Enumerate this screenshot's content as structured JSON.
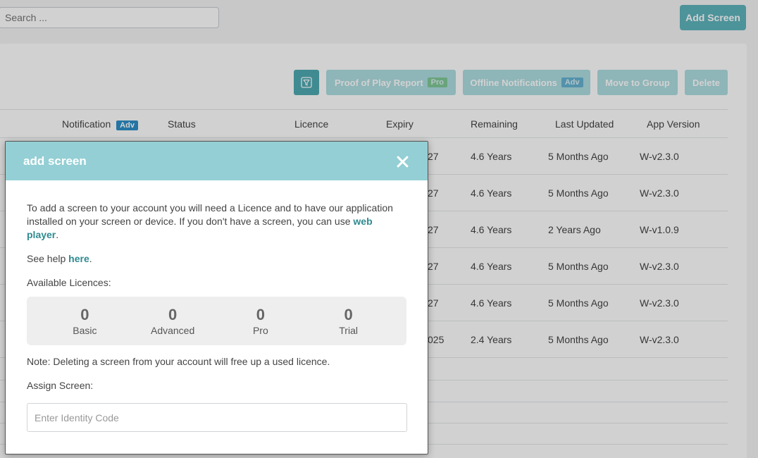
{
  "search": {
    "placeholder": "Search ..."
  },
  "header": {
    "add_screen_label": "Add Screen"
  },
  "toolbar": {
    "proof_of_play_label": "Proof of Play Report",
    "proof_of_play_tag": "Pro",
    "offline_notifications_label": "Offline Notifications",
    "offline_notifications_tag": "Adv",
    "move_to_group_label": "Move to Group",
    "delete_label": "Delete"
  },
  "table": {
    "columns": {
      "notification": "Notification",
      "notification_tag": "Adv",
      "status": "Status",
      "licence": "Licence",
      "expiry": "Expiry",
      "remaining": "Remaining",
      "last_updated": "Last Updated",
      "app_version": "App Version"
    },
    "rows": [
      {
        "expiry": "27",
        "remaining": "4.6 Years",
        "last_updated": "5 Months Ago",
        "app_version": "W-v2.3.0"
      },
      {
        "expiry": "27",
        "remaining": "4.6 Years",
        "last_updated": "5 Months Ago",
        "app_version": "W-v2.3.0"
      },
      {
        "expiry": "27",
        "remaining": "4.6 Years",
        "last_updated": "2 Years Ago",
        "app_version": "W-v1.0.9"
      },
      {
        "expiry": "27",
        "remaining": "4.6 Years",
        "last_updated": "5 Months Ago",
        "app_version": "W-v2.3.0"
      },
      {
        "expiry": "27",
        "remaining": "4.6 Years",
        "last_updated": "5 Months Ago",
        "app_version": "W-v2.3.0"
      },
      {
        "expiry": "025",
        "remaining": "2.4 Years",
        "last_updated": "5 Months Ago",
        "app_version": "W-v2.3.0"
      }
    ]
  },
  "modal": {
    "title": "add screen",
    "intro_text": "To add a screen to your account you will need a Licence and to have our application installed on your screen or device. If you don't have a screen, you can use ",
    "web_player_link": "web player",
    "intro_end": ".",
    "help_prefix": "See help ",
    "help_link": "here",
    "help_end": ".",
    "available_licences_label": "Available Licences:",
    "licences": [
      {
        "count": "0",
        "label": "Basic"
      },
      {
        "count": "0",
        "label": "Advanced"
      },
      {
        "count": "0",
        "label": "Pro"
      },
      {
        "count": "0",
        "label": "Trial"
      }
    ],
    "note": "Note: Deleting a screen from your account will free up a used licence.",
    "assign_label": "Assign Screen:",
    "identity_placeholder": "Enter Identity Code"
  },
  "colors": {
    "accent": "#5fb4bc",
    "modal_header": "#93cfd4",
    "link": "#2f8a90",
    "tag_pro": "#5cb85c",
    "tag_adv": "#2d8fc7"
  },
  "icons": {
    "filter": "filter-icon",
    "close": "close-icon"
  }
}
